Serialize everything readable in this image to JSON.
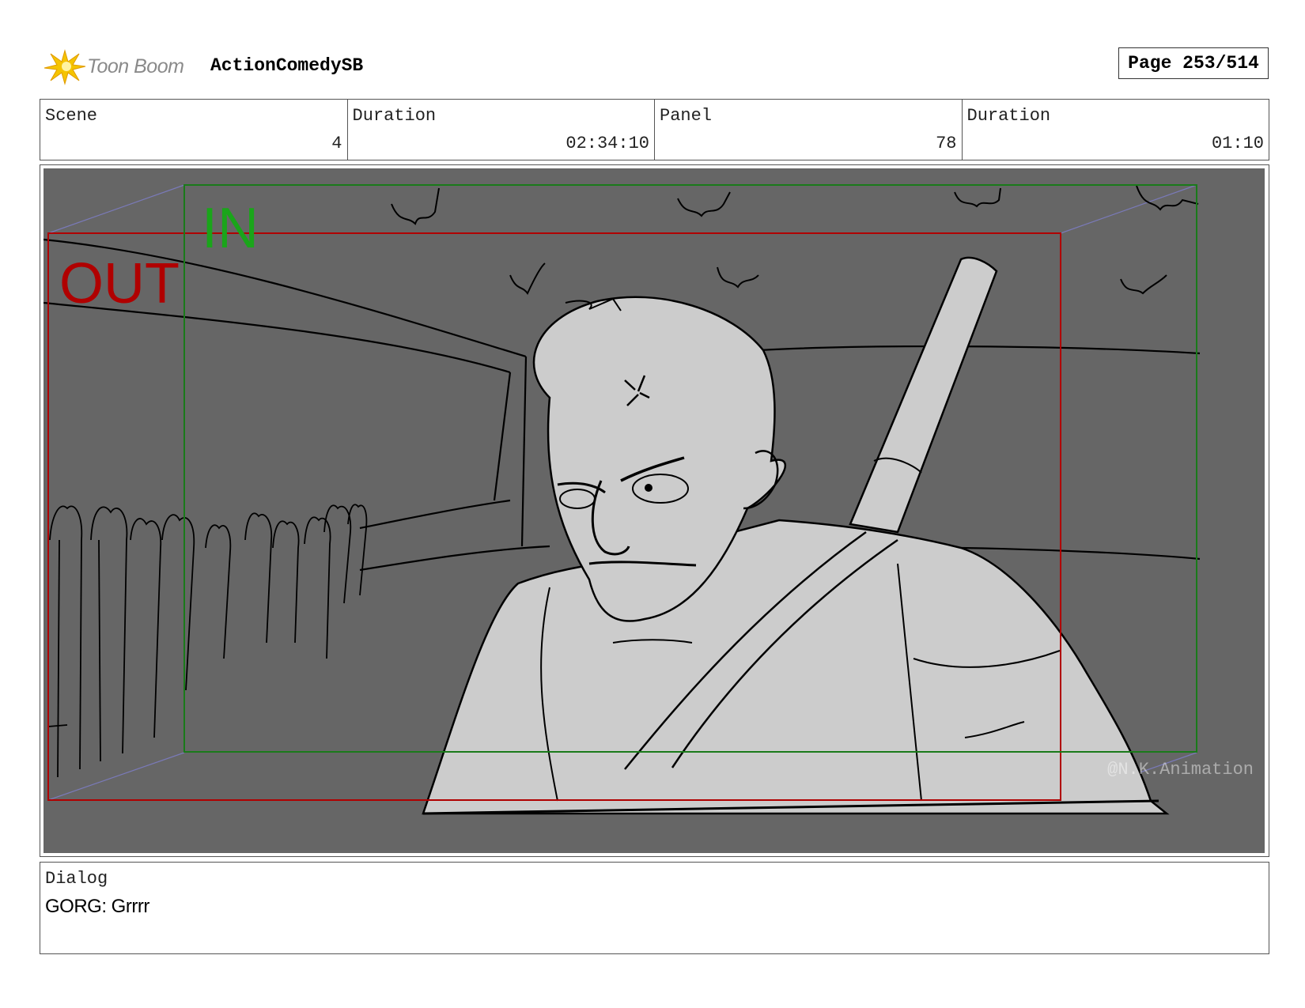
{
  "header": {
    "logo_text": "Toon Boom",
    "project_title": "ActionComedySB",
    "page_label": "Page 253/514"
  },
  "info": {
    "scene_label": "Scene",
    "scene_value": "4",
    "scene_duration_label": "Duration",
    "scene_duration_value": "02:34:10",
    "panel_label": "Panel",
    "panel_value": "78",
    "panel_duration_label": "Duration",
    "panel_duration_value": "01:10"
  },
  "panel": {
    "in_label": "IN",
    "out_label": "OUT",
    "watermark": "@N.K.Animation",
    "colors": {
      "background": "#666666",
      "in_frame": "#1aa51a",
      "out_frame": "#b00000",
      "character_fill": "#cccccc"
    }
  },
  "dialog": {
    "label": "Dialog",
    "text": "GORG: Grrrr"
  }
}
